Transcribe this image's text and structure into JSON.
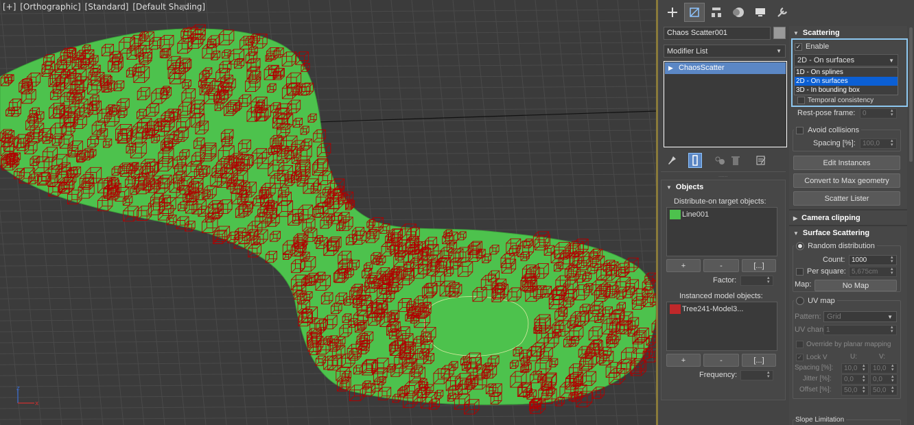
{
  "viewport": {
    "labels": [
      "[+]",
      "[Orthographic]",
      "[Standard]",
      "[Default Shading]"
    ],
    "axes": {
      "z": "z",
      "x": "x"
    },
    "colors": {
      "surface": "#4dc24d",
      "instances": "#b00000",
      "background": "#3b3b3b"
    }
  },
  "panel": {
    "tabs": [
      "create-icon",
      "modify-icon",
      "hierarchy-icon",
      "motion-icon",
      "display-icon",
      "utilities-icon"
    ],
    "object_name": "Chaos Scatter001",
    "modifier_list": "Modifier List",
    "stack": [
      "ChaosScatter"
    ],
    "objects": {
      "title": "Objects",
      "distribute_label": "Distribute-on target objects:",
      "targets": [
        {
          "name": "Line001",
          "color": "#4dc24d"
        }
      ],
      "add": "+",
      "remove": "-",
      "more": "[...]",
      "factor_label": "Factor:",
      "instanced_label": "Instanced model objects:",
      "instances": [
        {
          "name": "Tree241-Model3...",
          "color": "#c0282a"
        }
      ],
      "frequency_label": "Frequency:"
    },
    "scattering": {
      "title": "Scattering",
      "enable_label": "Enable",
      "mode_selected": "2D - On surfaces",
      "mode_options": [
        "1D - On splines",
        "2D - On surfaces",
        "3D - In bounding box"
      ],
      "temporal_label": "Temporal consistency",
      "rest_pose_label": "Rest-pose frame:",
      "rest_pose_value": "0",
      "avoid_collisions_label": "Avoid collisions",
      "spacing_label": "Spacing [%]:",
      "spacing_value": "100,0",
      "edit_instances": "Edit Instances",
      "convert": "Convert to Max geometry",
      "lister": "Scatter Lister"
    },
    "camera_clipping": {
      "title": "Camera clipping"
    },
    "surface": {
      "title": "Surface Scattering",
      "random_label": "Random distribution",
      "count_label": "Count:",
      "count_value": "1000",
      "per_square_label": "Per square:",
      "per_square_value": "5,675cm",
      "map_label": "Map:",
      "map_value": "No Map",
      "uv_label": "UV map",
      "pattern_label": "Pattern:",
      "pattern_value": "Grid",
      "uv_channel_label": "UV channel:",
      "uv_channel_value": "1",
      "override_label": "Override by planar mapping",
      "lockv_label": "Lock V",
      "u_label": "U:",
      "v_label": "V:",
      "spacing_label": "Spacing [%]:",
      "spacing_u": "10,0",
      "spacing_v": "10,0",
      "jitter_label": "Jitter [%]:",
      "jitter_u": "0,0",
      "jitter_v": "0,0",
      "offset_label": "Offset [%]:",
      "offset_u": "50,0",
      "offset_v": "50,0"
    },
    "slope": {
      "title": "Slope Limitation"
    }
  }
}
